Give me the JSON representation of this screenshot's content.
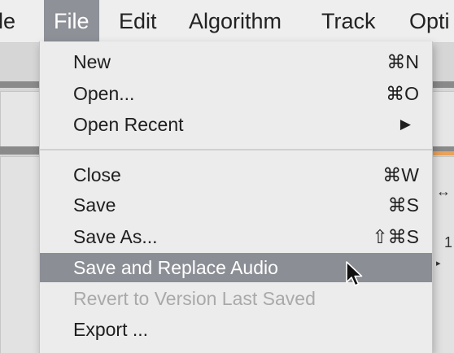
{
  "menubar": {
    "items": [
      {
        "label": "le"
      },
      {
        "label": "File"
      },
      {
        "label": "Edit"
      },
      {
        "label": "Algorithm"
      },
      {
        "label": "Track"
      },
      {
        "label": "Opti"
      }
    ]
  },
  "file_menu": {
    "groups": [
      [
        {
          "label": "New",
          "shortcut": "⌘N"
        },
        {
          "label": "Open...",
          "shortcut": "⌘O"
        },
        {
          "label": "Open Recent",
          "shortcut": "▶"
        }
      ],
      [
        {
          "label": "Close",
          "shortcut": "⌘W"
        },
        {
          "label": "Save",
          "shortcut": "⌘S"
        },
        {
          "label": "Save As...",
          "shortcut": "⇧⌘S"
        },
        {
          "label": "Save and Replace Audio",
          "shortcut": "",
          "highlighted": true
        },
        {
          "label": "Revert to Version Last Saved",
          "shortcut": "",
          "disabled": true
        },
        {
          "label": "Export ...",
          "shortcut": ""
        }
      ]
    ]
  },
  "background": {
    "snippets": [
      "↔",
      "1",
      "▸"
    ]
  },
  "colors": {
    "highlight": "#8b8e95",
    "menu_bg": "#ececec",
    "accent_orange": "#e9a35a"
  },
  "icons": {
    "cursor": "arrow-pointer-icon",
    "submenu": "chevron-right-icon"
  }
}
